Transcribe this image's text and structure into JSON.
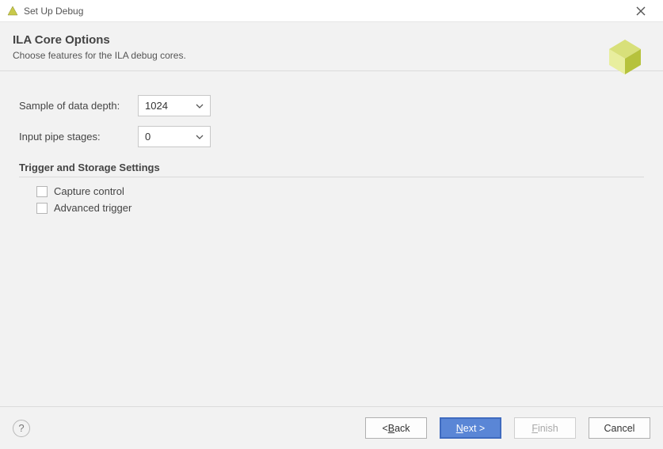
{
  "window": {
    "title": "Set Up Debug"
  },
  "header": {
    "title": "ILA Core Options",
    "description": "Choose features for the ILA debug cores."
  },
  "form": {
    "sample_depth_label": "Sample of data depth:",
    "sample_depth_value": "1024",
    "pipe_stages_label": "Input pipe stages:",
    "pipe_stages_value": "0"
  },
  "trigger_section": {
    "title": "Trigger and Storage Settings",
    "capture_control_label": "Capture control",
    "capture_control_checked": false,
    "advanced_trigger_label": "Advanced trigger",
    "advanced_trigger_checked": false
  },
  "footer": {
    "back_prefix": "< ",
    "back_mnemonic": "B",
    "back_rest": "ack",
    "next_mnemonic": "N",
    "next_rest": "ext >",
    "finish_mnemonic": "F",
    "finish_rest": "inish",
    "cancel_label": "Cancel",
    "help_label": "?"
  }
}
